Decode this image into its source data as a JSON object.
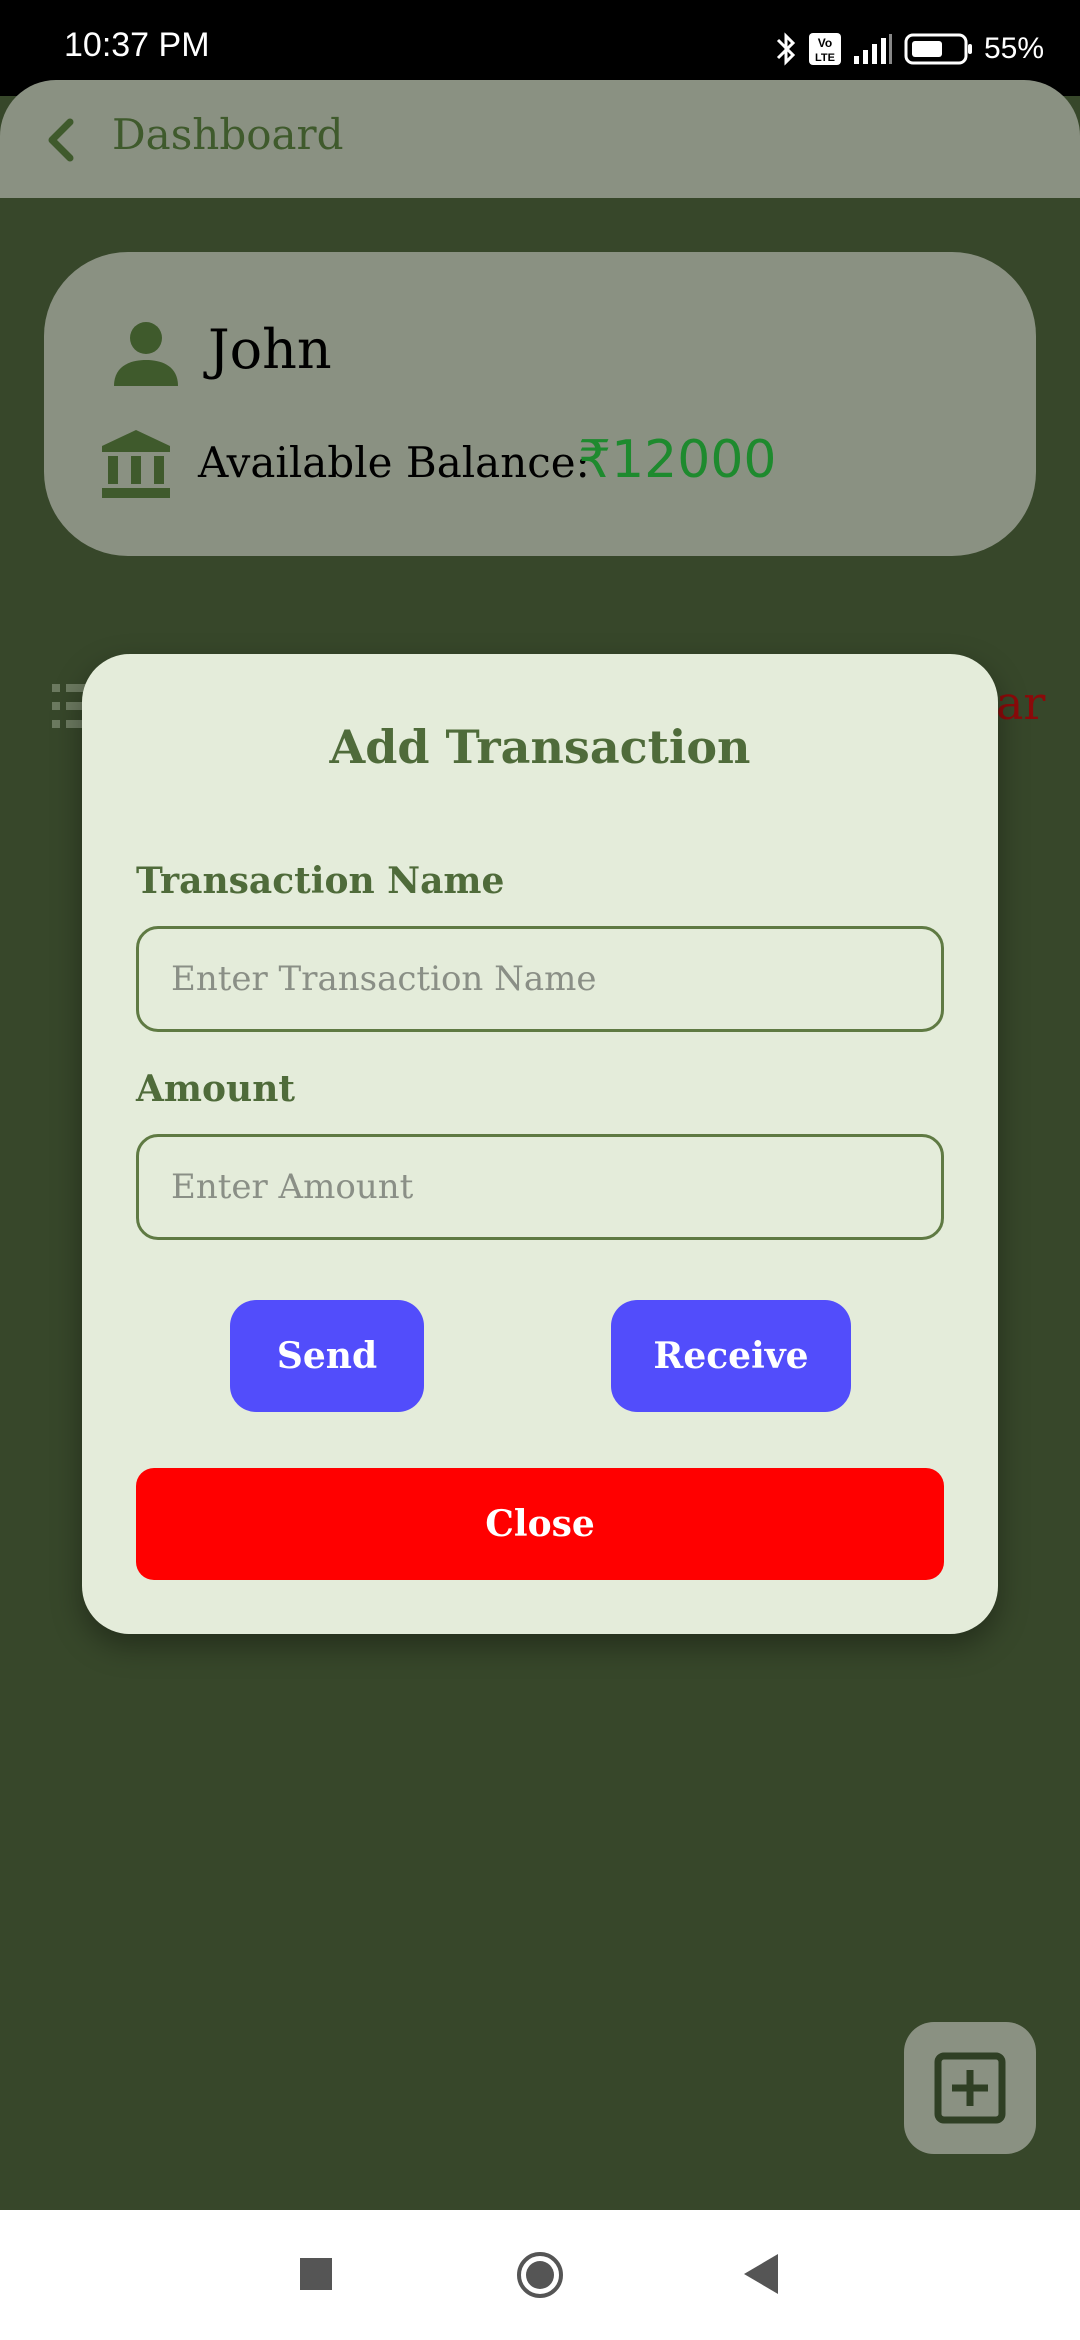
{
  "status_bar": {
    "time": "10:37 PM",
    "battery": "55%",
    "icons": [
      "bluetooth-icon",
      "volte-icon",
      "signal-icon",
      "battery-icon"
    ]
  },
  "appbar": {
    "title": "Dashboard"
  },
  "user_card": {
    "name": "John",
    "balance_label": "Available Balance:",
    "balance_value": "₹12000"
  },
  "background_peek_text": "ar",
  "dialog": {
    "title": "Add Transaction",
    "name_label": "Transaction Name",
    "name_placeholder": "Enter Transaction Name",
    "name_value": "",
    "amount_label": "Amount",
    "amount_placeholder": "Enter Amount",
    "amount_value": "",
    "send_label": "Send",
    "receive_label": "Receive",
    "close_label": "Close"
  },
  "colors": {
    "background": "#37472a",
    "card": "#8a9182",
    "dialog": "#e4ecda",
    "accent_green": "#4f6b3a",
    "balance_green": "#1e8a2e",
    "button_blue": "#524dfb",
    "close_red": "#ff0000"
  }
}
